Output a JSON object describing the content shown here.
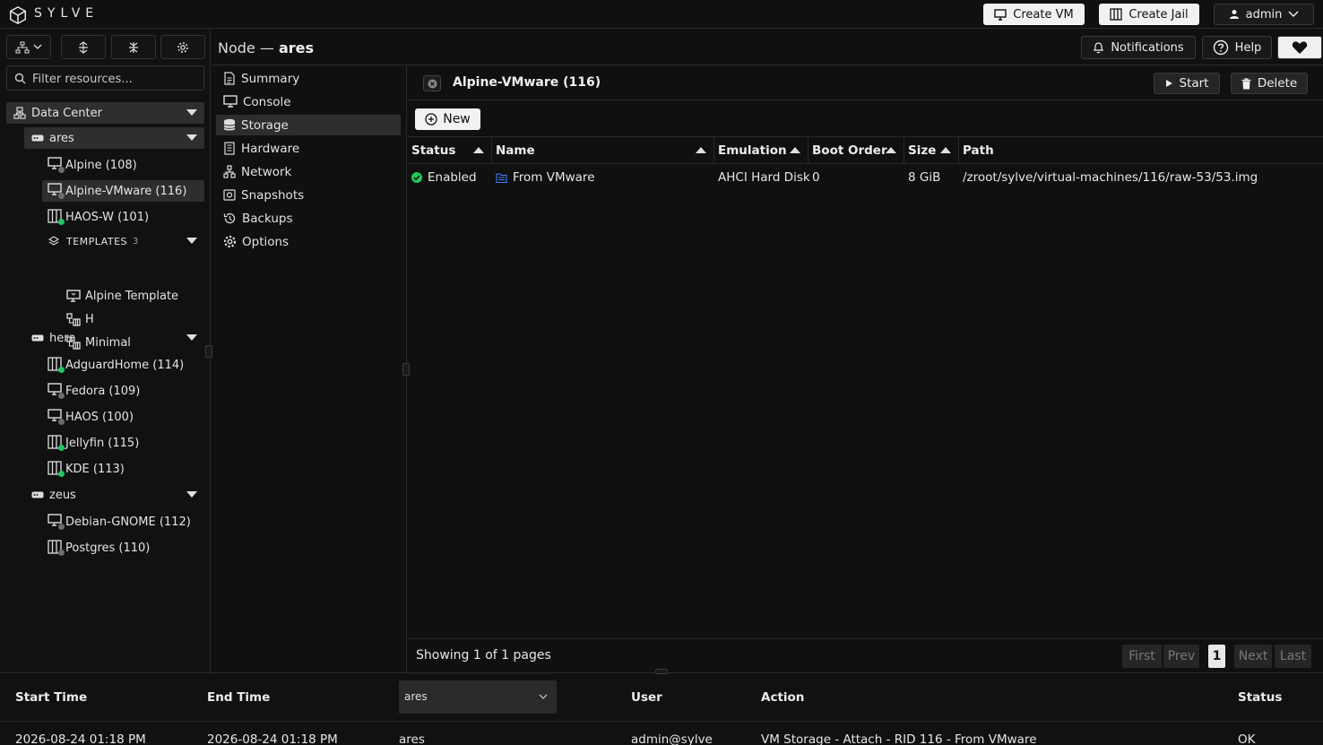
{
  "brand": {
    "name": "SYLVE"
  },
  "topbar": {
    "create_vm": "Create VM",
    "create_jail": "Create Jail",
    "user": "admin"
  },
  "sidebar": {
    "filter_placeholder": "Filter resources...",
    "datacenter": "Data Center",
    "nodes": [
      {
        "name": "ares",
        "items": [
          {
            "label": "Alpine (108)",
            "type": "vm",
            "status": "stopped"
          },
          {
            "label": "Alpine-VMware (116)",
            "type": "vm",
            "status": "stopped"
          },
          {
            "label": "HAOS-W (101)",
            "type": "jail",
            "status": "running"
          }
        ],
        "templates_label": "TEMPLATES",
        "templates_count": "3",
        "templates": [
          "Alpine Template",
          "H",
          "Minimal"
        ]
      },
      {
        "name": "hera",
        "items": [
          {
            "label": "AdguardHome (114)",
            "type": "jail",
            "status": "running"
          },
          {
            "label": "Fedora (109)",
            "type": "vm",
            "status": "stopped"
          },
          {
            "label": "HAOS (100)",
            "type": "vm",
            "status": "stopped"
          },
          {
            "label": "Jellyfin (115)",
            "type": "jail",
            "status": "running"
          },
          {
            "label": "KDE (113)",
            "type": "jail",
            "status": "running"
          }
        ]
      },
      {
        "name": "zeus",
        "items": [
          {
            "label": "Debian-GNOME (112)",
            "type": "vm",
            "status": "stopped"
          },
          {
            "label": "Postgres (110)",
            "type": "jail",
            "status": "stopped"
          }
        ]
      }
    ]
  },
  "header": {
    "node_prefix": "Node —",
    "node_name": "ares",
    "notifications": "Notifications",
    "help": "Help"
  },
  "submenu": [
    "Summary",
    "Console",
    "Storage",
    "Hardware",
    "Network",
    "Snapshots",
    "Backups",
    "Options"
  ],
  "submenu_selected": "Storage",
  "vm": {
    "title": "Alpine-VMware (116)",
    "start": "Start",
    "delete": "Delete",
    "new": "New"
  },
  "table": {
    "columns": [
      "Status",
      "Name",
      "Emulation",
      "Boot Order",
      "Size",
      "Path"
    ],
    "rows": [
      {
        "status": "Enabled",
        "name": "From VMware",
        "emulation": "AHCI Hard Disk",
        "boot_order": "0",
        "size": "8 GiB",
        "path": "/zroot/sylve/virtual-machines/116/raw-53/53.img"
      }
    ]
  },
  "pager": {
    "text": "Showing 1 of 1 pages",
    "first": "First",
    "prev": "Prev",
    "current": "1",
    "next": "Next",
    "last": "Last"
  },
  "log": {
    "columns": {
      "start": "Start Time",
      "end": "End Time",
      "user": "User",
      "action": "Action",
      "status": "Status"
    },
    "node_filter": "ares",
    "rows": [
      {
        "start": "2026-08-24 01:18 PM",
        "end": "2026-08-24 01:18 PM",
        "node": "ares",
        "user": "admin@sylve",
        "action": "VM Storage - Attach - RID 116 - From VMware",
        "status": "OK"
      }
    ]
  },
  "colors": {
    "running": "#22c55e",
    "stopped": "#6b6b6b",
    "accent": "#f2f2f2",
    "disk_icon": "#3b82f6"
  }
}
